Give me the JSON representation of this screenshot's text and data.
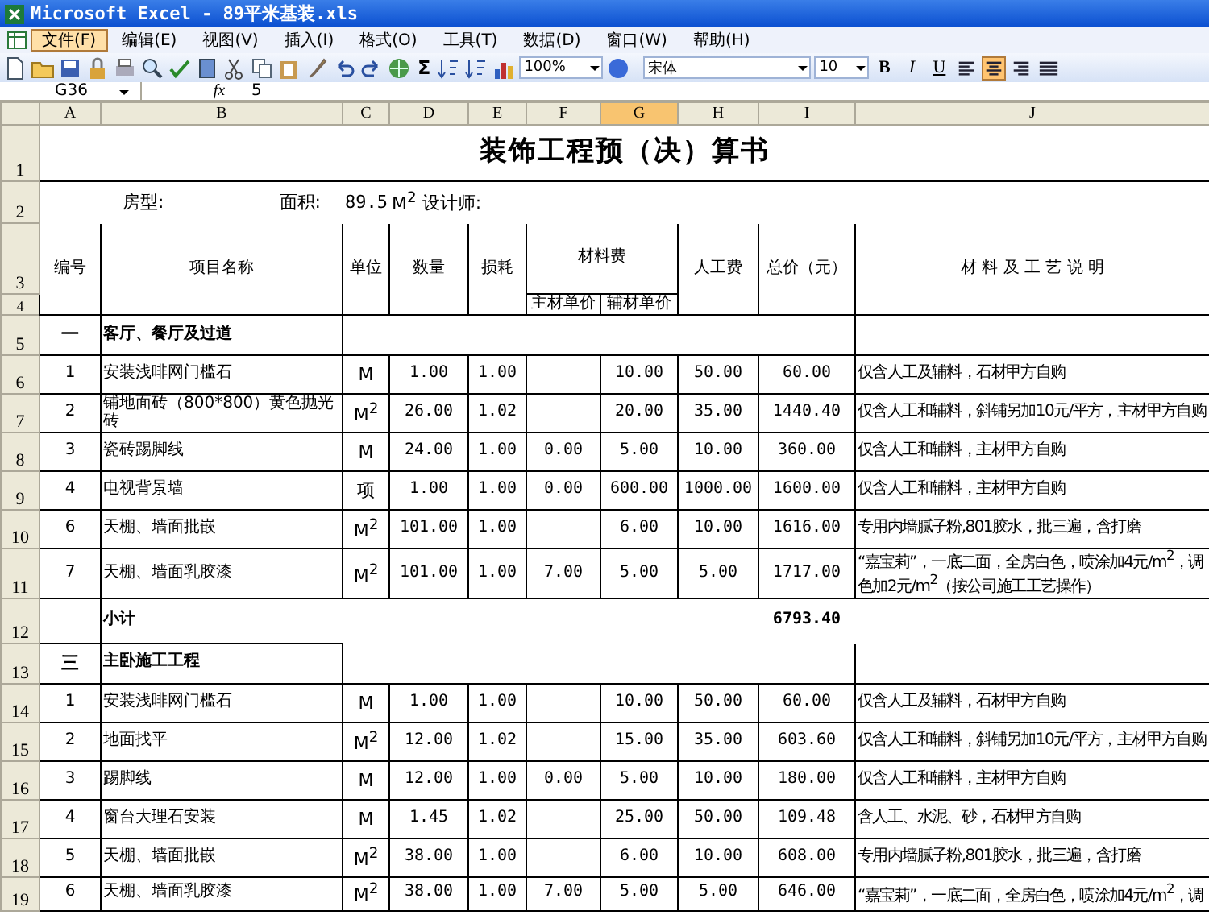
{
  "window": {
    "title": "Microsoft Excel - 89平米基装.xls"
  },
  "menu": [
    {
      "label": "文件(F)",
      "selected": true
    },
    {
      "label": "编辑(E)",
      "selected": false
    },
    {
      "label": "视图(V)",
      "selected": false
    },
    {
      "label": "插入(I)",
      "selected": false
    },
    {
      "label": "格式(O)",
      "selected": false
    },
    {
      "label": "工具(T)",
      "selected": false
    },
    {
      "label": "数据(D)",
      "selected": false
    },
    {
      "label": "窗口(W)",
      "selected": false
    },
    {
      "label": "帮助(H)",
      "selected": false
    }
  ],
  "toolbar": {
    "sum": "Σ",
    "zoom": "100%",
    "font": "宋体",
    "font_size": "10",
    "styles": [
      {
        "kind": "bold",
        "label": "B"
      },
      {
        "kind": "italic",
        "label": "I"
      },
      {
        "kind": "underline",
        "label": "U"
      }
    ],
    "align": [
      {
        "kind": "left",
        "selected": false
      },
      {
        "kind": "center",
        "selected": true
      },
      {
        "kind": "right",
        "selected": false
      },
      {
        "kind": "merge",
        "selected": false
      }
    ]
  },
  "formula_bar": {
    "name_box": "G36",
    "fx": "fx",
    "value": "5"
  },
  "columns": [
    {
      "label": "A",
      "selected": false
    },
    {
      "label": "B",
      "selected": false
    },
    {
      "label": "C",
      "selected": false
    },
    {
      "label": "D",
      "selected": false
    },
    {
      "label": "E",
      "selected": false
    },
    {
      "label": "F",
      "selected": false
    },
    {
      "label": "G",
      "selected": true
    },
    {
      "label": "H",
      "selected": false
    },
    {
      "label": "I",
      "selected": false
    },
    {
      "label": "J",
      "selected": false
    }
  ],
  "sheet": {
    "title": {
      "row": "1",
      "text": "装饰工程预（决）算书"
    },
    "info": {
      "row": "2",
      "type_label": "房型:",
      "area_label": "面积:",
      "area": "89.5",
      "unit": "M$^{2}$",
      "designer_label": "设计师:"
    },
    "header": {
      "rows": [
        "3",
        "4"
      ],
      "no": "编号",
      "name": "项目名称",
      "unit": "单位",
      "qty": "数量",
      "loss": "损耗",
      "material": "材料费",
      "main": "主材单价",
      "aux": "辅材单价",
      "labor": "人工费",
      "total": "总价（元）",
      "note": "材 料 及 工 艺 说 明"
    },
    "rows": [
      {
        "row": "5",
        "kind": "section",
        "no": "一",
        "name": "客厅、餐厅及过道"
      },
      {
        "row": "6",
        "kind": "item",
        "no": "1",
        "name": "安装浅啡网门槛石",
        "unit": "M",
        "qty": "1.00",
        "loss": "1.00",
        "aux": "10.00",
        "labor": "50.00",
        "total": "60.00",
        "note": "仅含人工及辅料，石材甲方自购"
      },
      {
        "row": "7",
        "kind": "item",
        "no": "2",
        "name": "铺地面砖（800*800）黄色抛光砖",
        "unit": "M$^{2}$",
        "qty": "26.00",
        "loss": "1.02",
        "aux": "20.00",
        "labor": "35.00",
        "total": "1440.40",
        "note": "仅含人工和辅料，斜铺另加10元/平方，主材甲方自购"
      },
      {
        "row": "8",
        "kind": "item",
        "no": "3",
        "name": "瓷砖踢脚线",
        "unit": "M",
        "qty": "24.00",
        "loss": "1.00",
        "main": "0.00",
        "aux": "5.00",
        "labor": "10.00",
        "total": "360.00",
        "note": "仅含人工和辅料，主材甲方自购"
      },
      {
        "row": "9",
        "kind": "item",
        "no": "4",
        "name": "电视背景墙",
        "unit": "项",
        "qty": "1.00",
        "loss": "1.00",
        "main": "0.00",
        "aux": "600.00",
        "labor": "1000.00",
        "total": "1600.00",
        "note": "仅含人工和辅料，主材甲方自购"
      },
      {
        "row": "10",
        "kind": "item",
        "no": "6",
        "name": "天棚、墙面批嵌",
        "unit": "M$^{2}$",
        "qty": "101.00",
        "loss": "1.00",
        "aux": "6.00",
        "labor": "10.00",
        "total": "1616.00",
        "note": "专用内墙腻子粉,801胶水，批三遍，含打磨"
      },
      {
        "row": "11",
        "kind": "item",
        "no": "7",
        "name": "天棚、墙面乳胶漆",
        "unit": "M$^{2}$",
        "qty": "101.00",
        "loss": "1.00",
        "main": "7.00",
        "aux": "5.00",
        "labor": "5.00",
        "total": "1717.00",
        "note": "“嘉宝莉”，一底二面，全房白色，喷涂加4元/m$^{2}$，调色加2元/m$^{2}$（按公司施工工艺操作）"
      },
      {
        "row": "12",
        "kind": "subtotal",
        "name": "小计",
        "total": "6793.40"
      },
      {
        "row": "13",
        "kind": "section",
        "no": "三",
        "name": "主卧施工工程"
      },
      {
        "row": "14",
        "kind": "item",
        "no": "1",
        "name": "安装浅啡网门槛石",
        "unit": "M",
        "qty": "1.00",
        "loss": "1.00",
        "aux": "10.00",
        "labor": "50.00",
        "total": "60.00",
        "note": "仅含人工及辅料，石材甲方自购"
      },
      {
        "row": "15",
        "kind": "item",
        "no": "2",
        "name": "地面找平",
        "unit": "M$^{2}$",
        "qty": "12.00",
        "loss": "1.02",
        "aux": "15.00",
        "labor": "35.00",
        "total": "603.60",
        "note": "仅含人工和辅料，斜铺另加10元/平方，主材甲方自购"
      },
      {
        "row": "16",
        "kind": "item",
        "no": "3",
        "name": "踢脚线",
        "unit": "M",
        "qty": "12.00",
        "loss": "1.00",
        "main": "0.00",
        "aux": "5.00",
        "labor": "10.00",
        "total": "180.00",
        "note": "仅含人工和辅料，主材甲方自购"
      },
      {
        "row": "17",
        "kind": "item",
        "no": "4",
        "name": "窗台大理石安装",
        "unit": "M",
        "qty": "1.45",
        "loss": "1.02",
        "aux": "25.00",
        "labor": "50.00",
        "total": "109.48",
        "note": "含人工、水泥、砂，石材甲方自购"
      },
      {
        "row": "18",
        "kind": "item",
        "no": "5",
        "name": "天棚、墙面批嵌",
        "unit": "M$^{2}$",
        "qty": "38.00",
        "loss": "1.00",
        "aux": "6.00",
        "labor": "10.00",
        "total": "608.00",
        "note": "专用内墙腻子粉,801胶水，批三遍，含打磨"
      },
      {
        "row": "19",
        "kind": "item",
        "no": "6",
        "name": "天棚、墙面乳胶漆",
        "unit": "M$^{2}$",
        "qty": "38.00",
        "loss": "1.00",
        "main": "7.00",
        "aux": "5.00",
        "labor": "5.00",
        "total": "646.00",
        "note": "“嘉宝莉”，一底二面，全房白色，喷涂加4元/m$^{2}$，调"
      }
    ]
  }
}
